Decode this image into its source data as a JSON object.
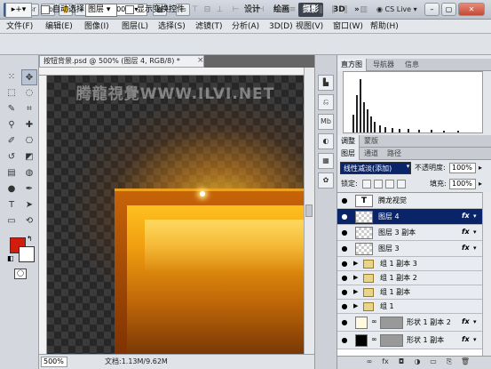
{
  "titlebar": {
    "app_logo": "Ps",
    "zoom": "500%",
    "workspaces": [
      "设计",
      "绘画",
      "摄影"
    ],
    "threed": "3D",
    "more": "»",
    "cslive": "CS Live",
    "icons": [
      "br-icon",
      "mb-icon",
      "hand-icon",
      "zoom-icon",
      "rotate-icon",
      "arrange-icon",
      "screen-mode-icon"
    ]
  },
  "menu": [
    "文件(F)",
    "编辑(E)",
    "图像(I)",
    "图层(L)",
    "选择(S)",
    "滤镜(T)",
    "分析(A)",
    "3D(D)",
    "视图(V)",
    "窗口(W)",
    "帮助(H)"
  ],
  "options": {
    "tool": "▸+",
    "auto_select": "自动选择:",
    "auto_select_value": "图层",
    "show_transform": "显示变换控件"
  },
  "document": {
    "tab_title": "按钮背景.psd @ 500% (图层 4, RGB/8) *",
    "close": "×",
    "watermark": "腾龍視覺WWW.ILVI.NET",
    "zoom_field": "500%",
    "doc_info": "文档:1.13M/9.62M"
  },
  "panels": {
    "top_tabs": [
      "直方图",
      "导航器",
      "信息"
    ],
    "mid_tabs": [
      "调整",
      "蒙版"
    ],
    "layer_tabs": [
      "图层",
      "通道",
      "路径"
    ],
    "blend_mode": "线性减淡(添加)",
    "opacity_label": "不透明度:",
    "opacity": "100%",
    "lock_label": "锁定:",
    "fill_label": "填充:",
    "fill": "100%"
  },
  "layers": [
    {
      "name": "腾龙视觉",
      "kind": "text",
      "fx": false,
      "selected": false
    },
    {
      "name": "图层 4",
      "kind": "pixel",
      "fx": true,
      "selected": true
    },
    {
      "name": "图层 3 副本",
      "kind": "pixel",
      "fx": true,
      "selected": false
    },
    {
      "name": "图层 3",
      "kind": "pixel",
      "fx": true,
      "selected": false
    },
    {
      "name": "组 1 副本 3",
      "kind": "group",
      "fx": false,
      "selected": false
    },
    {
      "name": "组 1 副本 2",
      "kind": "group",
      "fx": false,
      "selected": false
    },
    {
      "name": "组 1 副本",
      "kind": "group",
      "fx": false,
      "selected": false
    },
    {
      "name": "组 1",
      "kind": "group",
      "fx": false,
      "selected": false
    },
    {
      "name": "形状 1 副本 2",
      "kind": "shape",
      "fx": true,
      "selected": false
    },
    {
      "name": "形状 1 副本",
      "kind": "shape",
      "fx": true,
      "selected": false
    }
  ],
  "colors": {
    "foreground": "#d31d0c",
    "background": "#ffffff",
    "selection": "#0a246a"
  }
}
